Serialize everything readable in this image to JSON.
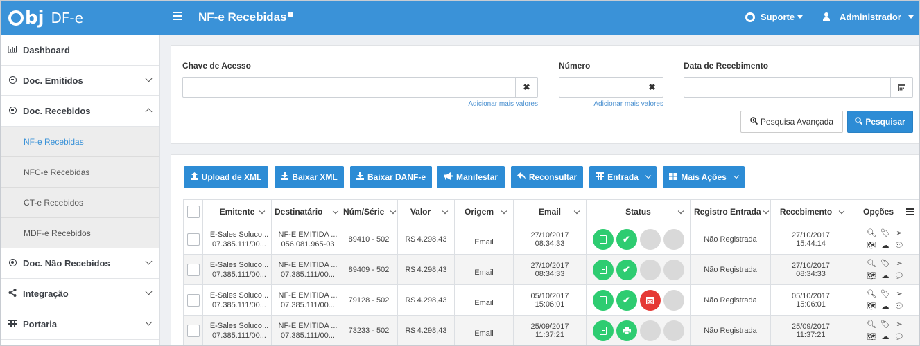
{
  "brand": {
    "logo": "obj",
    "product": "DF-e"
  },
  "header": {
    "title": "NF-e Recebidas",
    "info_badge": "i",
    "support_label": "Suporte",
    "user_label": "Administrador"
  },
  "sidebar": {
    "items": [
      {
        "label": "Dashboard",
        "icon": "bar-chart-icon"
      },
      {
        "label": "Doc. Emitidos",
        "icon": "arrow-circle-right-icon"
      },
      {
        "label": "Doc. Recebidos",
        "icon": "arrow-circle-left-icon"
      },
      {
        "label": "Doc. Não Recebidos",
        "icon": "dot-circle-icon"
      },
      {
        "label": "Integração",
        "icon": "share-icon"
      },
      {
        "label": "Portaria",
        "icon": "gate-icon"
      }
    ],
    "subitems": [
      {
        "label": "NF-e Recebidas",
        "active": true
      },
      {
        "label": "NFC-e Recebidas"
      },
      {
        "label": "CT-e Recebidos"
      },
      {
        "label": "MDF-e Recebidos"
      }
    ]
  },
  "filter": {
    "chave_label": "Chave de Acesso",
    "chave_value": "",
    "numero_label": "Número",
    "numero_value": "",
    "data_label": "Data de Recebimento",
    "data_value": "",
    "add_more_1": "Adicionar mais valores",
    "add_more_2": "Adicionar mais valores",
    "advanced_search": "Pesquisa Avançada",
    "search": "Pesquisar"
  },
  "toolbar": {
    "upload_xml": "Upload de XML",
    "baixar_xml": "Baixar XML",
    "baixar_danfe": "Baixar DANF-e",
    "manifestar": "Manifestar",
    "reconsultar": "Reconsultar",
    "entrada": "Entrada",
    "mais_acoes": "Mais Ações"
  },
  "table": {
    "columns": [
      "Emitente",
      "Destinatário",
      "Núm/Série",
      "Valor",
      "Origem",
      "Email",
      "Status",
      "Registro Entrada",
      "Recebimento",
      "Opções"
    ],
    "rows": [
      {
        "emit1": "E-Sales Soluco...",
        "emit2": "07.385.111/00...",
        "dest1": "NF-E EMITIDA ...",
        "dest2": "056.081.965-03",
        "num": "89410 - 502",
        "valor": "R$ 4.298,43",
        "origem": "Email",
        "email1": "27/10/2017",
        "email2": "08:34:33",
        "registro": "Não Registrada",
        "rec1": "27/10/2017",
        "rec2": "15:44:14"
      },
      {
        "emit1": "E-Sales Soluco...",
        "emit2": "07.385.111/00...",
        "dest1": "NF-E EMITIDA ...",
        "dest2": "07.385.111/00...",
        "num": "89409 - 502",
        "valor": "R$ 4.298,43",
        "origem": "Email",
        "email1": "27/10/2017",
        "email2": "08:34:33",
        "registro": "Não Registrada",
        "rec1": "27/10/2017",
        "rec2": "08:34:33"
      },
      {
        "emit1": "E-Sales Soluco...",
        "emit2": "07.385.111/00...",
        "dest1": "NF-E EMITIDA ...",
        "dest2": "07.385.111/00...",
        "num": "79128 - 502",
        "valor": "R$ 4.298,43",
        "origem": "Email",
        "email1": "05/10/2017",
        "email2": "15:06:01",
        "registro": "Não Registrada",
        "rec1": "05/10/2017",
        "rec2": "15:06:01"
      },
      {
        "emit1": "E-Sales Soluco...",
        "emit2": "07.385.111/00...",
        "dest1": "NF-E EMITIDA ...",
        "dest2": "07.385.111/00...",
        "num": "73233 - 502",
        "valor": "R$ 4.298,43",
        "origem": "Email",
        "email1": "25/09/2017",
        "email2": "11:37:21",
        "registro": "Não Registrada",
        "rec1": "25/09/2017",
        "rec2": "11:37:21"
      }
    ]
  },
  "colors": {
    "primary": "#3a92d8",
    "button": "#2d8cd5",
    "status_green": "#2ecc71",
    "status_red": "#e53935",
    "status_gray": "#d9d9d9"
  }
}
